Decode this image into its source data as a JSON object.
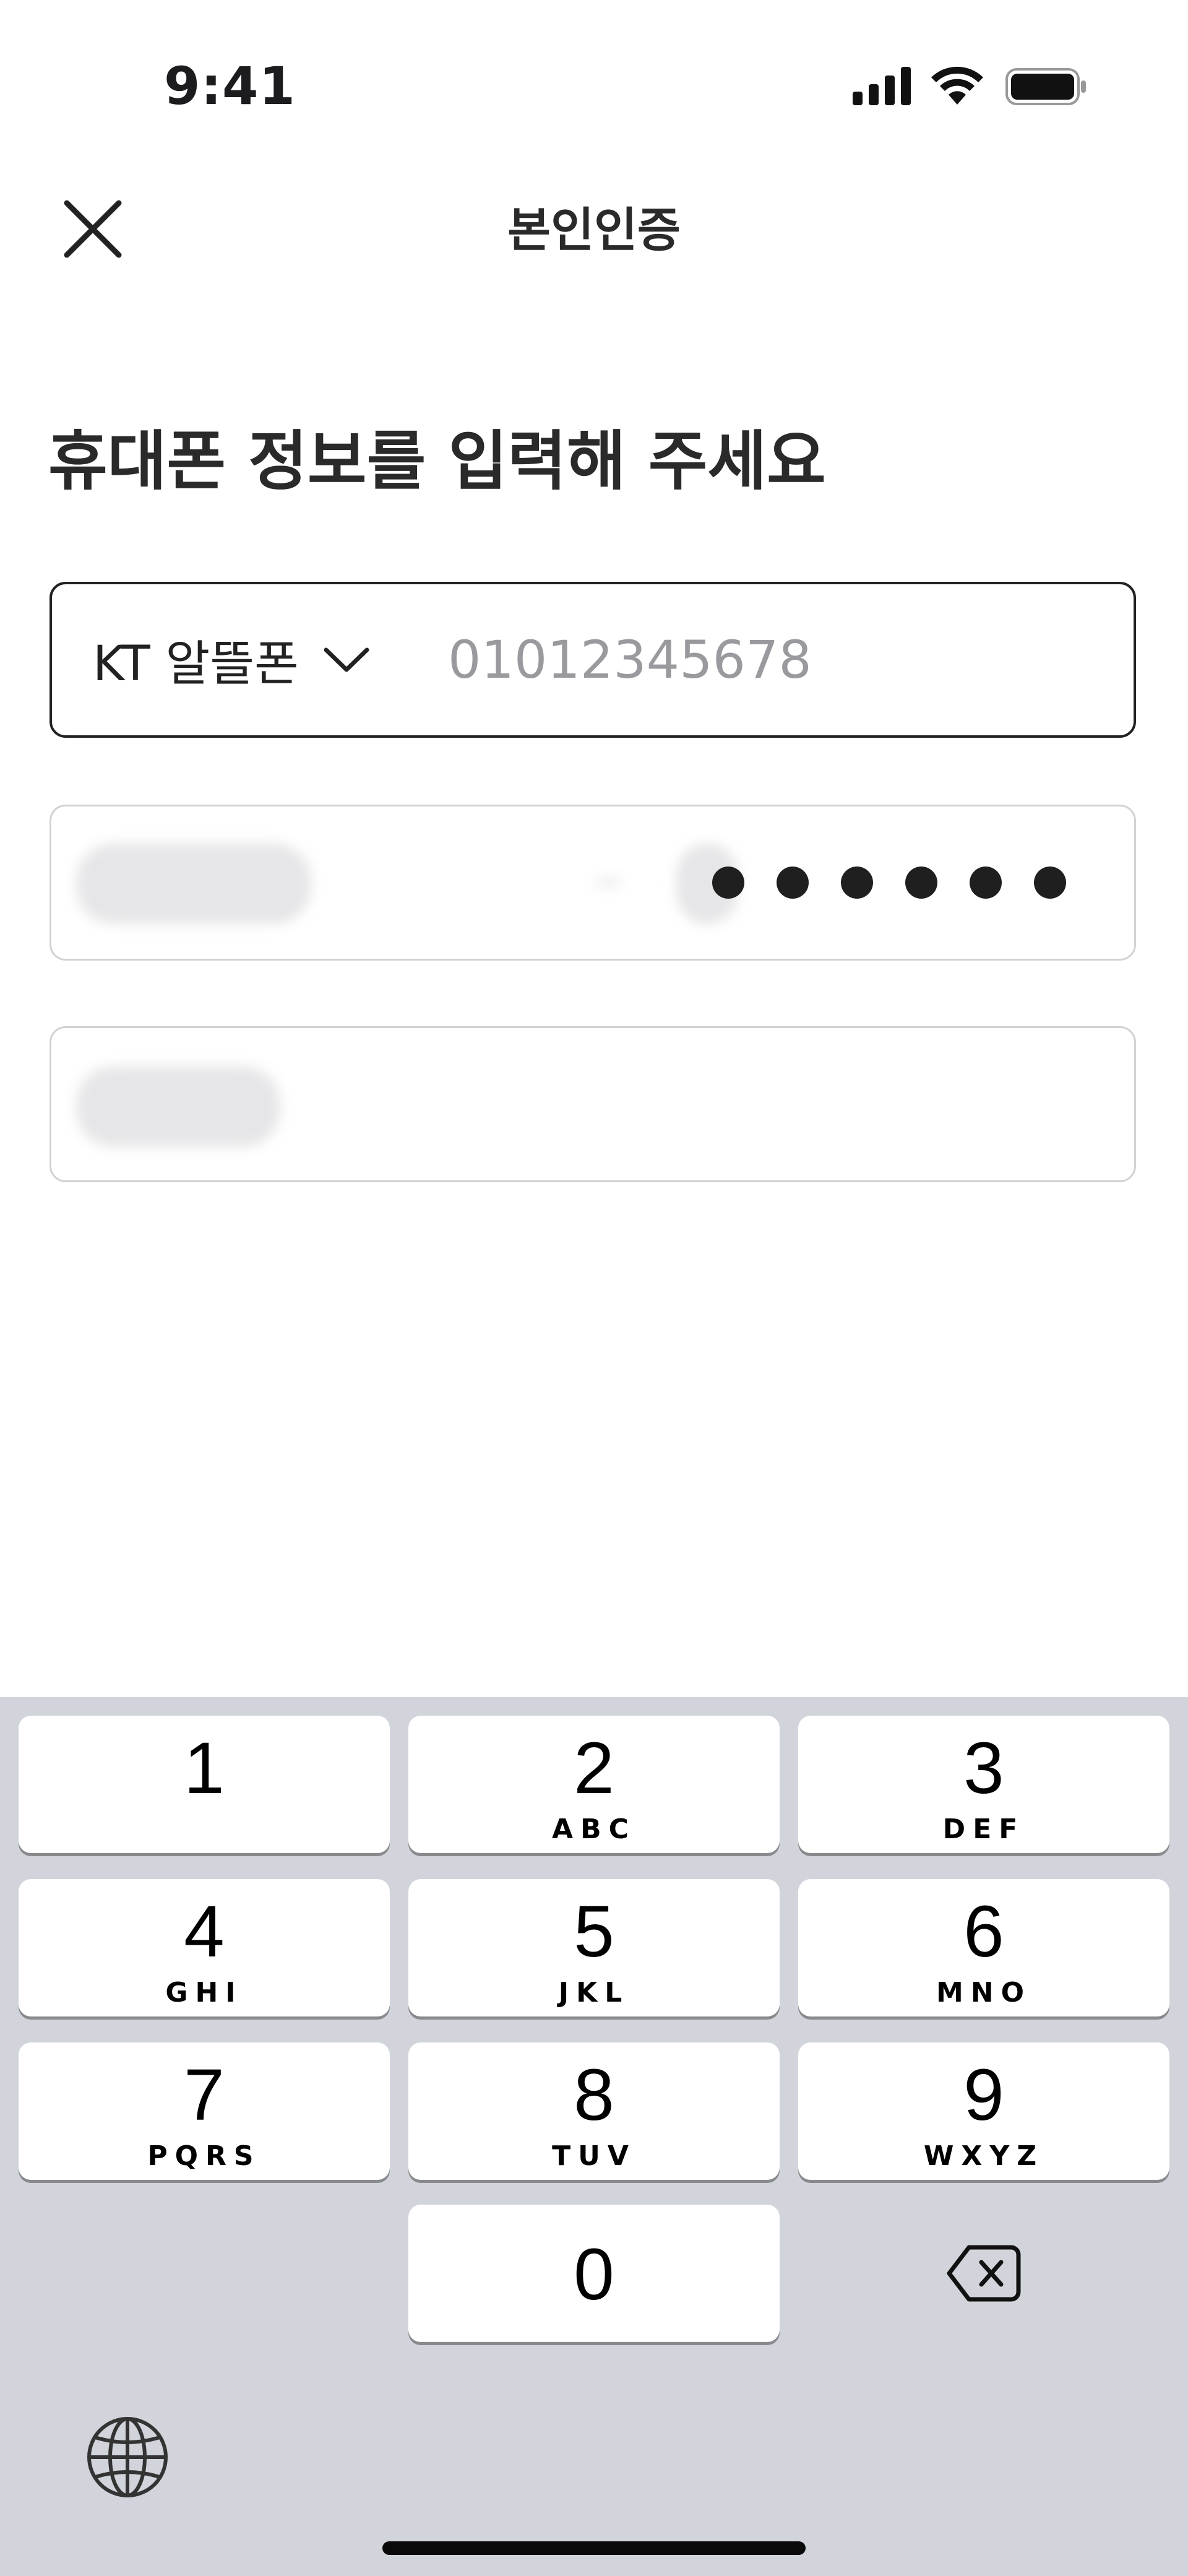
{
  "status_bar": {
    "time": "9:41",
    "icons": [
      "signal-icon",
      "wifi-icon",
      "battery-icon"
    ]
  },
  "header": {
    "title": "본인인증",
    "close_icon": "close-icon"
  },
  "page": {
    "title": "휴대폰 정보를 입력해 주세요"
  },
  "phone_field": {
    "carrier": "KT 알뜰폰",
    "carrier_icon": "chevron-down-icon",
    "placeholder": "01012345678",
    "value": ""
  },
  "keyboard": {
    "keys": [
      {
        "num": "1",
        "letters": ""
      },
      {
        "num": "2",
        "letters": "ABC"
      },
      {
        "num": "3",
        "letters": "DEF"
      },
      {
        "num": "4",
        "letters": "GHI"
      },
      {
        "num": "5",
        "letters": "JKL"
      },
      {
        "num": "6",
        "letters": "MNO"
      },
      {
        "num": "7",
        "letters": "PQRS"
      },
      {
        "num": "8",
        "letters": "TUV"
      },
      {
        "num": "9",
        "letters": "WXYZ"
      },
      {
        "num": "0",
        "letters": ""
      }
    ],
    "delete_icon": "delete-icon",
    "globe_icon": "globe-icon"
  },
  "colors": {
    "background": "#ffffff",
    "keyboard_bg": "#d1d4db",
    "key_bg": "#ffffff",
    "active_border": "#222222",
    "inactive_border": "#d2d2d6",
    "placeholder": "#9a9a9e"
  }
}
